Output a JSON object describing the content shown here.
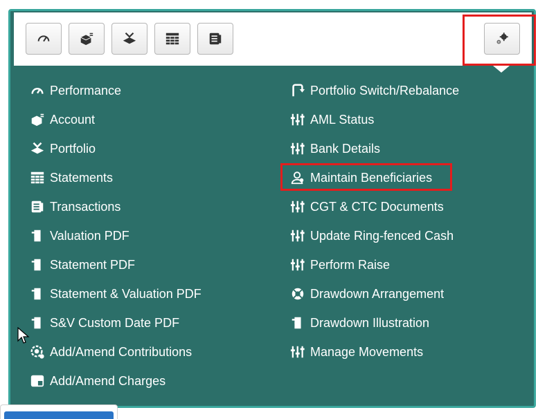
{
  "toolbar": {
    "buttons": [
      {
        "icon": "speedometer-icon"
      },
      {
        "icon": "cube-icon"
      },
      {
        "icon": "portfolio-icon"
      },
      {
        "icon": "table-icon"
      },
      {
        "icon": "transactions-icon"
      }
    ],
    "settings_icon": "gears-icon"
  },
  "menu": {
    "left": [
      {
        "label": "Performance",
        "icon": "speedometer-icon"
      },
      {
        "label": "Account",
        "icon": "cube-icon"
      },
      {
        "label": "Portfolio",
        "icon": "portfolio-icon"
      },
      {
        "label": "Statements",
        "icon": "table-icon"
      },
      {
        "label": "Transactions",
        "icon": "transactions-icon"
      },
      {
        "label": "Valuation PDF",
        "icon": "document-icon"
      },
      {
        "label": "Statement PDF",
        "icon": "document-icon"
      },
      {
        "label": "Statement & Valuation PDF",
        "icon": "document-icon"
      },
      {
        "label": "S&V Custom Date PDF",
        "icon": "document-icon"
      },
      {
        "label": "Add/Amend Contributions",
        "icon": "contributions-icon"
      },
      {
        "label": "Add/Amend Charges",
        "icon": "charges-icon"
      }
    ],
    "right": [
      {
        "label": "Portfolio Switch/Rebalance",
        "icon": "switch-icon"
      },
      {
        "label": "AML Status",
        "icon": "sliders-icon"
      },
      {
        "label": "Bank Details",
        "icon": "sliders-icon"
      },
      {
        "label": "Maintain Beneficiaries",
        "icon": "user-icon"
      },
      {
        "label": "CGT & CTC Documents",
        "icon": "sliders-icon"
      },
      {
        "label": "Update Ring-fenced Cash",
        "icon": "sliders-icon"
      },
      {
        "label": "Perform Raise",
        "icon": "sliders-icon"
      },
      {
        "label": "Drawdown Arrangement",
        "icon": "life-ring-icon"
      },
      {
        "label": "Drawdown Illustration",
        "icon": "document-icon"
      },
      {
        "label": "Manage Movements",
        "icon": "sliders-icon"
      }
    ]
  },
  "colors": {
    "panel": "#2c6f69",
    "border": "#3aa79d",
    "highlight": "#e41d1d"
  }
}
